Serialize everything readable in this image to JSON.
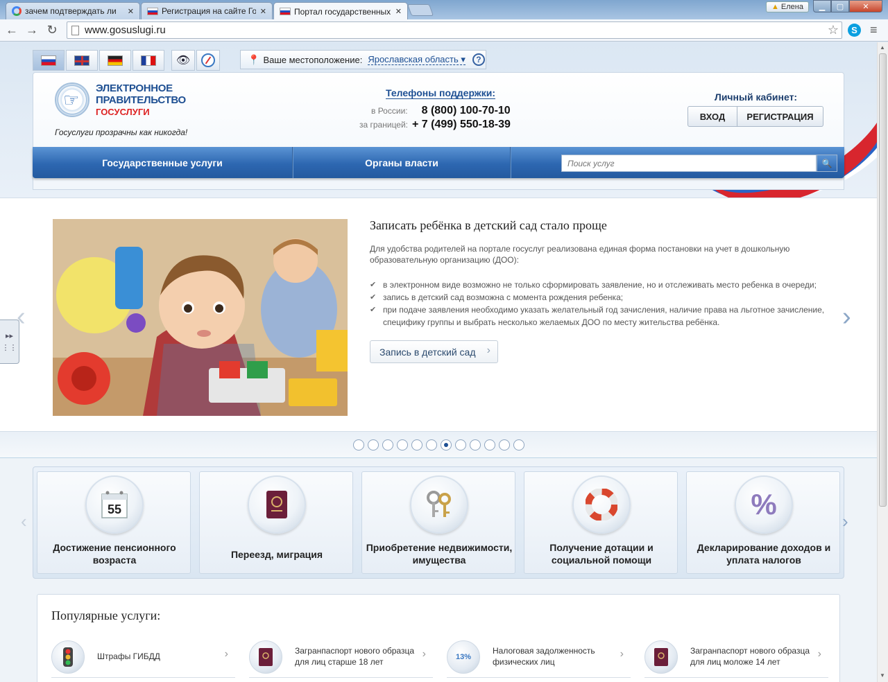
{
  "browser": {
    "tabs": [
      {
        "label": "зачем подтверждать ли"
      },
      {
        "label": "Регистрация на сайте Го"
      },
      {
        "label": "Портал государственных"
      }
    ],
    "url": "www.gosuslugi.ru",
    "user": "Елена"
  },
  "header": {
    "location_label": "Ваше местоположение:",
    "location_value": "Ярославская область",
    "logo_line1": "ЭЛЕКТРОННОЕ",
    "logo_line2": "ПРАВИТЕЛЬСТВО",
    "logo_line3": "ГОСУСЛУГИ",
    "slogan": "Госуслуги прозрачны как никогда!",
    "phones_title": "Телефоны поддержки",
    "phone_ru_label": "в России:",
    "phone_ru": "8 (800) 100-70-10",
    "phone_abroad_label": "за границей:",
    "phone_abroad": "+ 7 (499) 550-18-39",
    "cabinet_title": "Личный кабинет:",
    "login": "ВХОД",
    "register": "РЕГИСТРАЦИЯ"
  },
  "nav": {
    "item1": "Государственные услуги",
    "item2": "Органы власти",
    "search_placeholder": "Поиск услуг"
  },
  "slide": {
    "title": "Записать ребёнка в детский сад стало проще",
    "description": "Для удобства родителей на портале госуслуг реализована единая форма постановки на учет в дошкольную образовательную организацию (ДОО):",
    "bullets": [
      "в электронном виде возможно не только сформировать заявление, но и отслеживать место ребенка в очереди;",
      "запись в детский сад возможна с момента рождения ребенка;",
      "при подаче заявления необходимо указать желательный год зачисления, наличие права на льготное зачисление, специфику группы и выбрать несколько желаемых ДОО по месту жительства ребёнка."
    ],
    "button": "Запись в детский сад",
    "dots_total": 12,
    "dots_active_index": 6
  },
  "categories": [
    {
      "label": "Достижение пенсионного возраста"
    },
    {
      "label": "Переезд, миграция"
    },
    {
      "label": "Приобретение недвижимости, имущества"
    },
    {
      "label": "Получение дотации и социальной помощи"
    },
    {
      "label": "Декларирование доходов и уплата налогов"
    }
  ],
  "calendar_digit": "55",
  "popular": {
    "title": "Популярные услуги:",
    "items": [
      {
        "label": "Штрафы ГИБДД"
      },
      {
        "label": "Загранпаспорт нового образца для лиц старше 18 лет"
      },
      {
        "label": "Налоговая задолженность физических лиц"
      },
      {
        "label": "Загранпаспорт нового образца для лиц моложе 14 лет"
      }
    ],
    "tax_badge": "13%"
  },
  "colors": {
    "brand_blue": "#1d4f93",
    "nav_blue": "#2d67b1",
    "brand_red": "#d22"
  }
}
